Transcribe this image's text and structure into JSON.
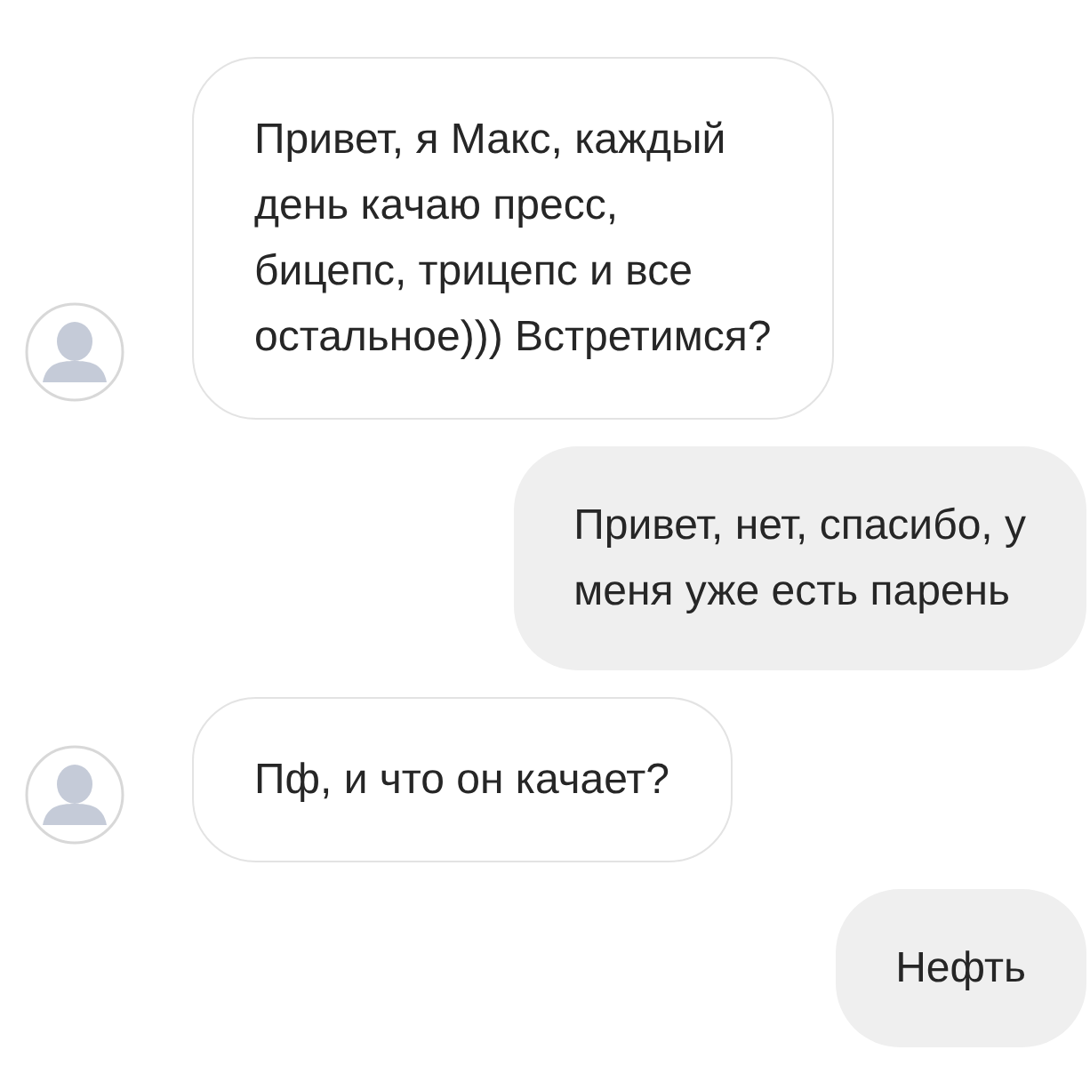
{
  "messages": [
    {
      "kind": "incoming",
      "text": "Привет, я Макс, каждый\nдень качаю пресс,\nбицепс, трицепс и все\nостальное))) Встретимся?"
    },
    {
      "kind": "outgoing",
      "text": "Привет, нет, спасибо, у\nменя уже есть парень"
    },
    {
      "kind": "incoming",
      "text": "Пф, и что он качает?"
    },
    {
      "kind": "outgoing",
      "text": "Нефть"
    }
  ]
}
